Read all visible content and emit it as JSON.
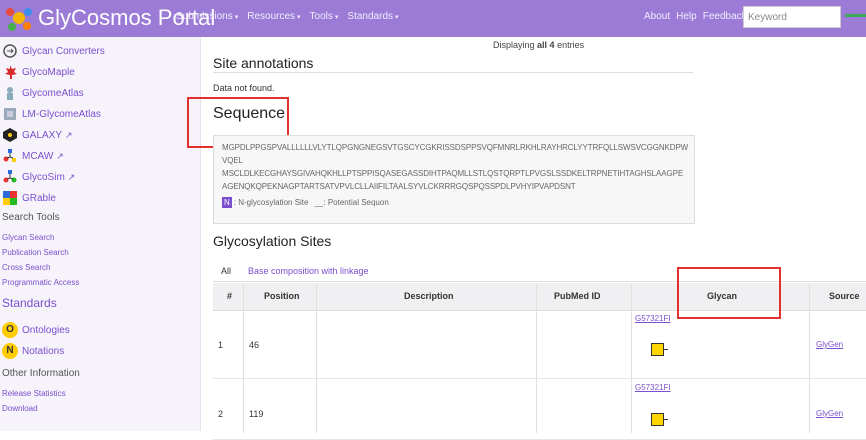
{
  "header": {
    "brand": "GlyCosmos Portal",
    "nav": [
      "Submissions",
      "Resources",
      "Tools",
      "Standards"
    ],
    "right_links": [
      "About",
      "Help",
      "Feedback"
    ],
    "search_placeholder": "Keyword"
  },
  "sidebar": {
    "tools": [
      {
        "label": "Glycan Converters",
        "icon": "converter-icon"
      },
      {
        "label": "GlycoMaple",
        "icon": "maple-leaf-icon"
      },
      {
        "label": "GlycomeAtlas",
        "icon": "atlas-icon"
      },
      {
        "label": "LM-GlycomeAtlas",
        "icon": "lm-atlas-icon"
      },
      {
        "label": "GALAXY",
        "icon": "galaxy-icon"
      },
      {
        "label": "MCAW",
        "icon": "mcaw-icon"
      },
      {
        "label": "GlycoSim",
        "icon": "glycosim-icon"
      },
      {
        "label": "GRable",
        "icon": "grable-icon"
      }
    ],
    "search_tools_heading": "Search Tools",
    "search_tools": [
      "Glycan Search",
      "Publication Search",
      "Cross Search",
      "Programmatic Access"
    ],
    "standards_heading": "Standards",
    "standards": [
      {
        "label": "Ontologies",
        "badge": "O"
      },
      {
        "label": "Notations",
        "badge": "N"
      }
    ],
    "other_heading": "Other Information",
    "other": [
      "Release Statistics",
      "Download"
    ]
  },
  "main": {
    "displaying_prefix": "Displaying",
    "displaying_bold": "all 4",
    "displaying_suffix": "entries",
    "site_annotations_title": "Site annotations",
    "no_data": "Data not found.",
    "sequence_title": "Sequence",
    "sequence_lines": [
      "MGPDLPPGSPVALLLLLLVLYTLQPGNGNEGSVTGSCYCGKRISSDSPPSVQFMNRLRKHLRAYHRCLYYTRFQLLSWSVCGGNKDPWVQEL",
      "MSCLDLKECGHAYSGIVAHQKHLLPTSPPISQASEGASSDIHTPAQMLLSTLQSTQRPTLPVGSLSSDKELTRPNETIHTAGHSLAAGPE",
      "AGENQKQPEKNAGPTARTSATVPVLCLLAIIFILTAALSYVLCKRRRGQSPQSSPDLPVHYIPVAPDSNT"
    ],
    "legend_badge": "N",
    "legend_site": ": N-glycosylation Site",
    "legend_potential_mark": "__",
    "legend_potential": ": Potential Sequon",
    "glycosylation_title": "Glycosylation Sites",
    "tabs": [
      "All",
      "Base composition with linkage"
    ],
    "table": {
      "headers": [
        "#",
        "Position",
        "Description",
        "PubMed ID",
        "Glycan",
        "Source"
      ],
      "rows": [
        {
          "num": "1",
          "position": "46",
          "glycan": "G57321FI",
          "source": "GlyGen"
        },
        {
          "num": "2",
          "position": "119",
          "glycan": "G57321FI",
          "source": "GlyGen"
        }
      ]
    }
  },
  "colors": {
    "header": "#9b7bd6",
    "accent": "#7a4fcf",
    "highlight": "#e03030",
    "glycan": "#ffd400"
  }
}
